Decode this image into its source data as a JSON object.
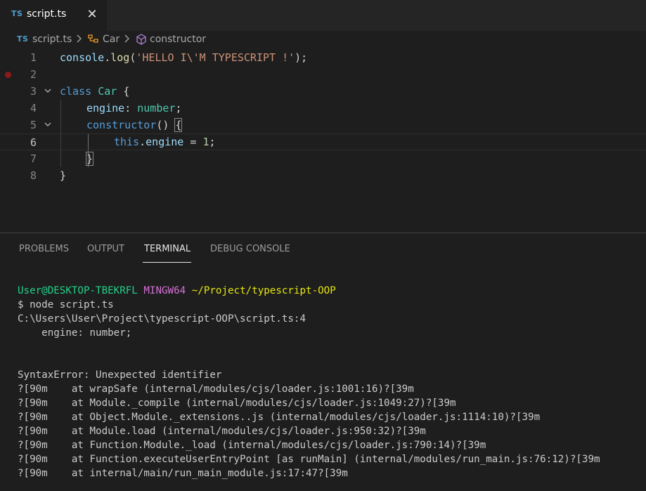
{
  "tab": {
    "badge": "TS",
    "label": "script.ts",
    "close": "✕"
  },
  "breadcrumb": {
    "badge": "TS",
    "file": "script.ts",
    "class_name": "Car",
    "member": "constructor",
    "separator": ">"
  },
  "editor": {
    "line_numbers": [
      "1",
      "2",
      "3",
      "4",
      "5",
      "6",
      "7",
      "8"
    ],
    "fold_glyph": "⌄",
    "breakpoint_line": "2",
    "current_line": "6",
    "tokens": {
      "l1_console": "console",
      "l1_dot": ".",
      "l1_log": "log",
      "l1_open": "(",
      "l1_str": "'HELLO I\\'M TYPESCRIPT !'",
      "l1_close": ");",
      "l3_class": "class",
      "l3_name": "Car",
      "l3_brace": " {",
      "l4_prop": "engine",
      "l4_colon": ": ",
      "l4_type": "number",
      "l4_semi": ";",
      "l5_ctor": "constructor",
      "l5_parens": "() ",
      "l5_brace": "{",
      "l6_this": "this",
      "l6_dot": ".",
      "l6_prop": "engine",
      "l6_eq": " = ",
      "l6_num": "1",
      "l6_semi": ";",
      "l7_brace": "}",
      "l8_brace": "}"
    }
  },
  "panel": {
    "tabs": [
      "PROBLEMS",
      "OUTPUT",
      "TERMINAL",
      "DEBUG CONSOLE"
    ],
    "active_tab": "TERMINAL"
  },
  "terminal": {
    "prompt_user": "User@DESKTOP-TBEKRFL",
    "prompt_env": "MINGW64",
    "prompt_path": "~/Project/typescript-OOP",
    "command": "$ node script.ts",
    "error_location": "C:\\Users\\User\\Project\\typescript-OOP\\script.ts:4",
    "error_source": "    engine: number;",
    "error_message": "SyntaxError: Unexpected identifier",
    "stack": [
      "?[90m    at wrapSafe (internal/modules/cjs/loader.js:1001:16)?[39m",
      "?[90m    at Module._compile (internal/modules/cjs/loader.js:1049:27)?[39m",
      "?[90m    at Object.Module._extensions..js (internal/modules/cjs/loader.js:1114:10)?[39m",
      "?[90m    at Module.load (internal/modules/cjs/loader.js:950:32)?[39m",
      "?[90m    at Function.Module._load (internal/modules/cjs/loader.js:790:14)?[39m",
      "?[90m    at Function.executeUserEntryPoint [as runMain] (internal/modules/run_main.js:76:12)?[39m",
      "?[90m    at internal/main/run_main_module.js:17:47?[39m"
    ]
  },
  "colors": {
    "background": "#1e1e1e",
    "ts_badge": "#4f9fcf",
    "prompt_green": "#23d18b",
    "prompt_magenta": "#d670d6",
    "prompt_yellow": "#e5e510"
  }
}
